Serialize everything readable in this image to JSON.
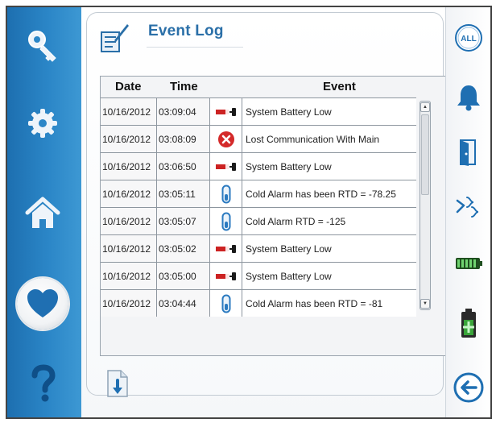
{
  "header": {
    "title": "Event Log"
  },
  "table": {
    "columns": [
      "Date",
      "Time",
      "",
      "Event"
    ],
    "rows": [
      {
        "date": "10/16/2012",
        "time": "03:09:04",
        "icon": "battery-icon",
        "event": "System Battery Low"
      },
      {
        "date": "10/16/2012",
        "time": "03:08:09",
        "icon": "error-x-icon",
        "event": "Lost Communication With Main"
      },
      {
        "date": "10/16/2012",
        "time": "03:06:50",
        "icon": "battery-icon",
        "event": "System Battery Low"
      },
      {
        "date": "10/16/2012",
        "time": "03:05:11",
        "icon": "thermometer-icon",
        "event": "Cold Alarm has been RTD = -78.25"
      },
      {
        "date": "10/16/2012",
        "time": "03:05:07",
        "icon": "thermometer-icon",
        "event": "Cold Alarm RTD = -125"
      },
      {
        "date": "10/16/2012",
        "time": "03:05:02",
        "icon": "battery-icon",
        "event": "System Battery Low"
      },
      {
        "date": "10/16/2012",
        "time": "03:05:00",
        "icon": "battery-icon",
        "event": "System Battery Low"
      },
      {
        "date": "10/16/2012",
        "time": "03:04:44",
        "icon": "thermometer-icon",
        "event": "Cold Alarm has been RTD = -81"
      }
    ]
  },
  "left_nav": [
    {
      "icon": "key-icon"
    },
    {
      "icon": "gear-icon"
    },
    {
      "icon": "home-icon"
    },
    {
      "icon": "heart-icon",
      "active": true
    },
    {
      "icon": "help-icon"
    }
  ],
  "right_nav": {
    "all_label": "ALL",
    "items": [
      "all-icon",
      "bell-icon",
      "door-icon",
      "probe-icon",
      "battery-level-icon",
      "battery-charge-icon",
      "back-icon"
    ]
  },
  "colors": {
    "rail_blue": "#2b86c7",
    "title_blue": "#2a6fa8",
    "error_red": "#d42a2a",
    "therm_blue": "#2b7ac0",
    "battery_green": "#3aa53a"
  }
}
